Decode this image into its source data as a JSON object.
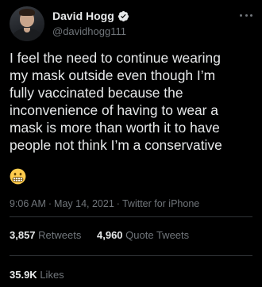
{
  "author": {
    "display_name": "David Hogg",
    "handle": "@davidhogg111",
    "verified": true,
    "verified_color": "#1d9bf0"
  },
  "tweet": {
    "lines": [
      "I feel the need to continue wearing",
      "my mask outside even though I’m",
      "fully vaccinated because the",
      "inconvenience of having to wear a",
      "mask is more than worth it to have",
      "people not think I’m a conservative"
    ],
    "emoji": "grimacing-face-icon"
  },
  "meta": {
    "time": "9:06 AM",
    "date": "May 14, 2021",
    "source": "Twitter for iPhone",
    "separator": "·"
  },
  "stats": {
    "retweets_count": "3,857",
    "retweets_label": "Retweets",
    "quotes_count": "4,960",
    "quotes_label": "Quote Tweets",
    "likes_count": "35.9K",
    "likes_label": "Likes"
  },
  "colors": {
    "background": "#000000",
    "text": "#e7e9ea",
    "muted": "#71767b",
    "divider": "#2f3336"
  }
}
